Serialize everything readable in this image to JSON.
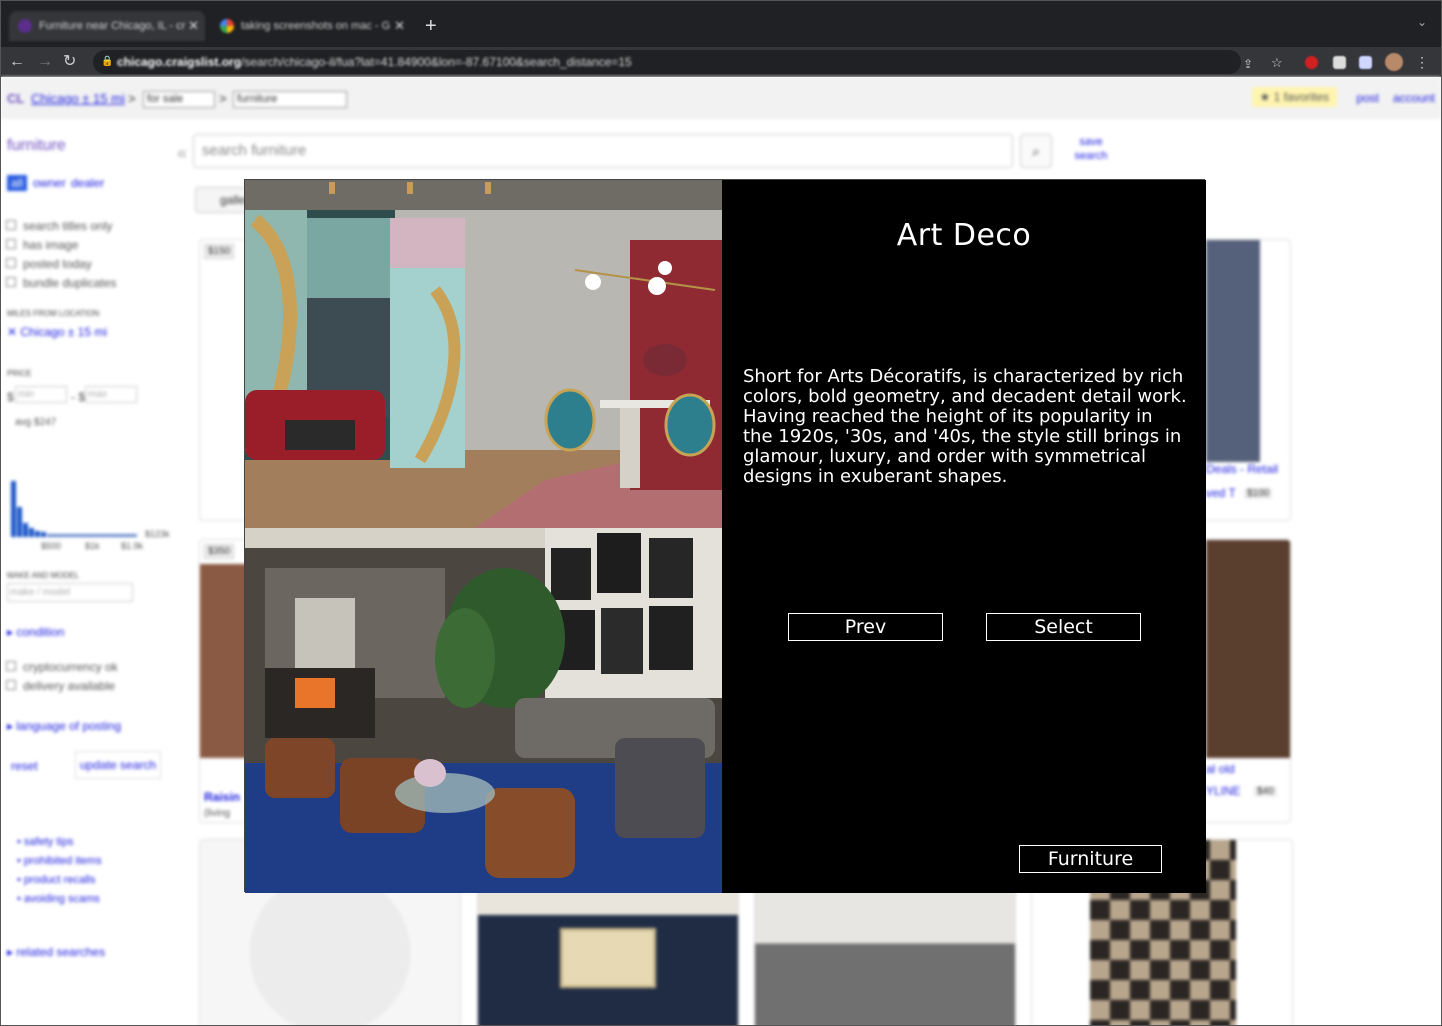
{
  "browser": {
    "tabs": [
      {
        "title": "Furniture near Chicago, IL - cr"
      },
      {
        "title": "taking screenshots on mac - G"
      }
    ],
    "url_host": "chicago.craigslist.org",
    "url_path": "/search/chicago-il/fua?lat=41.84900&lon=-87.67100&search_distance=15"
  },
  "craigslist": {
    "logo": "CL",
    "location": "Chicago ± 15 mi",
    "category_select": "for sale",
    "subcategory_select": "furniture",
    "favorites": "1 favorites",
    "post_link": "post",
    "account_link": "account",
    "sidebar": {
      "title": "furniture",
      "filter_all": "all",
      "filter_owner": "owner",
      "filter_dealer": "dealer",
      "checkboxes": [
        "search titles only",
        "has image",
        "posted today",
        "bundle duplicates"
      ],
      "miles_label": "MILES FROM LOCATION",
      "location_chip": "Chicago ± 15 mi",
      "price_label": "PRICE",
      "min_placeholder": "min",
      "max_placeholder": "max",
      "avg": "avg $247",
      "hist_ticks": [
        "$500",
        "$1k",
        "$1.9k",
        "$123k"
      ],
      "make_label": "MAKE AND MODEL",
      "make_placeholder": "make / model",
      "condition": "condition",
      "checkboxes2": [
        "cryptocurrency ok",
        "delivery available"
      ],
      "language": "language of posting",
      "reset": "reset",
      "update": "update search",
      "links": [
        "safety tips",
        "prohibited items",
        "product recalls",
        "avoiding scams"
      ],
      "related": "related searches"
    },
    "search_placeholder": "search furniture",
    "save_search": "save search",
    "gallery": "gallery",
    "cards": [
      {
        "price": "$150"
      },
      {
        "price": "$350"
      },
      {
        "title_a": "Deals - Retail",
        "title_b": "ved T",
        "price": "$100"
      },
      {
        "title_a": "al old",
        "title_b": "YLINE",
        "price": "$40"
      },
      {
        "title": "Raisin",
        "subtitle": "(living"
      }
    ]
  },
  "modal": {
    "title": "Art Deco",
    "description": "Short for Arts Décoratifs, is characterized by rich colors, bold geometry, and decadent detail work. Having reached the height of its popularity in the 1920s, '30s, and '40s, the style still brings in glamour, luxury, and order with symmetrical designs in exuberant shapes.",
    "prev_label": "Prev",
    "select_label": "Select",
    "category_label": "Furniture"
  },
  "colors": {
    "modal_bg": "#000000",
    "modal_text": "#ffffff",
    "cl_link": "#2020e0",
    "chrome_dark": "#202124"
  }
}
